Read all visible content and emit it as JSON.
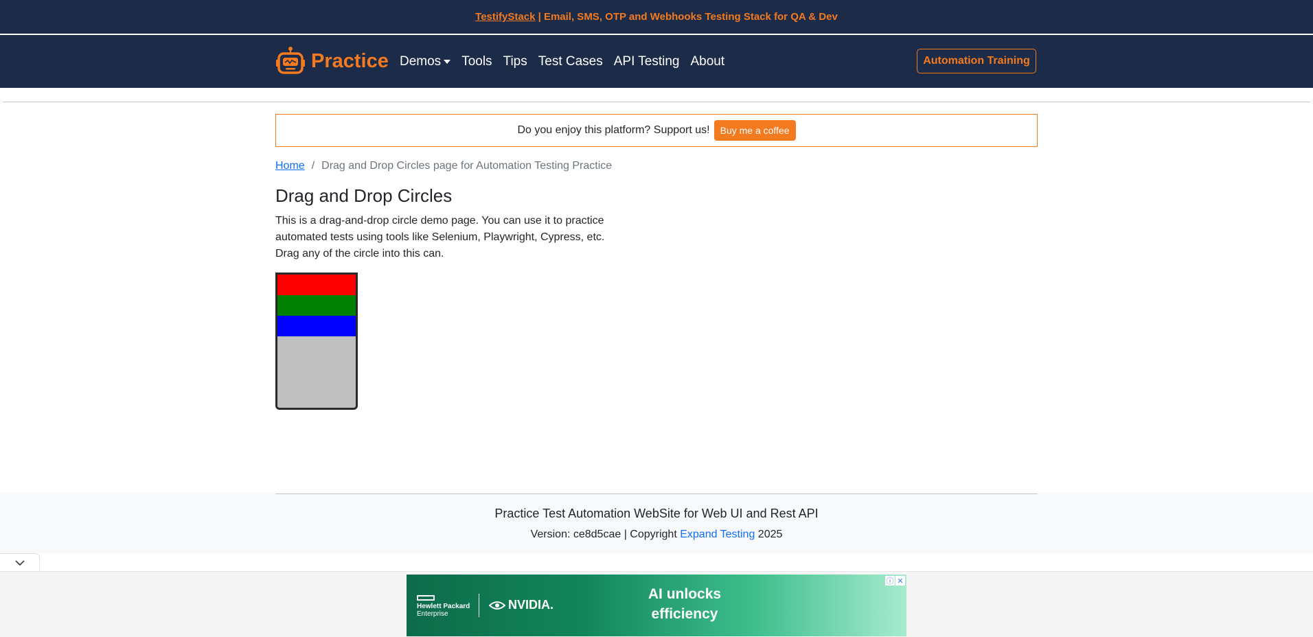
{
  "topbar": {
    "link_text": "TestifyStack",
    "rest_text": " | Email, SMS, OTP and Webhooks Testing Stack for QA & Dev"
  },
  "navbar": {
    "brand": "Practice",
    "items": [
      "Demos",
      "Tools",
      "Tips",
      "Test Cases",
      "API Testing",
      "About"
    ],
    "cta": "Automation Training"
  },
  "support": {
    "text": "Do you enjoy this platform? Support us!",
    "button": "Buy me a coffee"
  },
  "breadcrumb": {
    "home": "Home",
    "separator": "/",
    "current": "Drag and Drop Circles page for Automation Testing Practice"
  },
  "main": {
    "title": "Drag and Drop Circles",
    "description": [
      "This is a drag-and-drop circle demo page. You can use it to practice",
      "automated tests using tools like Selenium, Playwright, Cypress, etc.",
      "Drag any of the circle into this can."
    ],
    "can": {
      "stripes": [
        "#ff0000",
        "#008000",
        "#0000ff"
      ],
      "fill_color": "#c0c0c0"
    }
  },
  "footer": {
    "title": "Practice Test Automation WebSite for Web UI and Rest API",
    "version_prefix": "Version: ce8d5cae | Copyright ",
    "link": "Expand Testing",
    "year": " 2025"
  },
  "ad": {
    "hpe_line1": "Hewlett Packard",
    "hpe_line2": "Enterprise",
    "nvidia": "NVIDIA.",
    "headline": "AI unlocks efficiency"
  },
  "colors": {
    "navy": "#1b2b48",
    "accent": "#f47a20",
    "link": "#0d6efd"
  }
}
